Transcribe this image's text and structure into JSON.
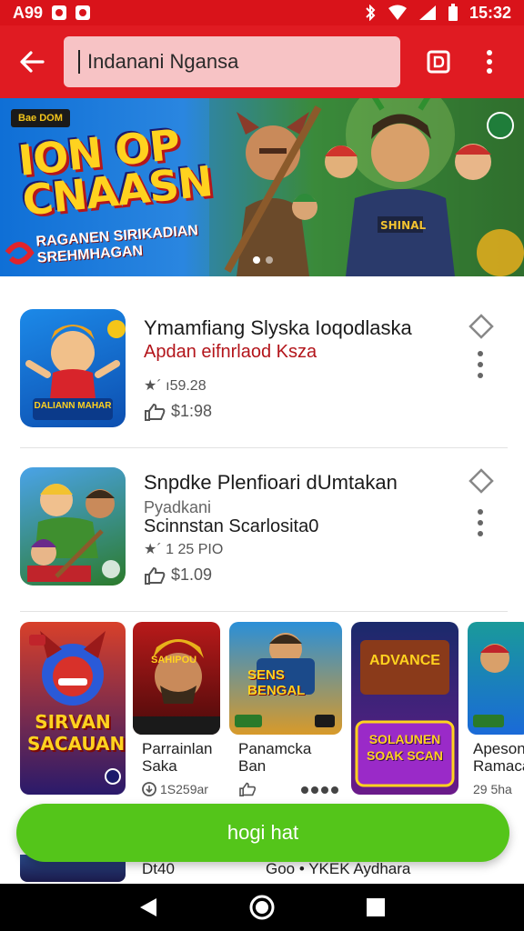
{
  "status_bar": {
    "left_text": "A99",
    "time": "15:32"
  },
  "search": {
    "value": "Indanani Ngansa"
  },
  "banner": {
    "tag": "Bae DOM",
    "title_line1": "ION OP",
    "title_line2": "CNAASN",
    "subtitle": "RAGANEN SIRIKADIAN SREHMHAGAN",
    "shirt_text": "SHINAL"
  },
  "list_items": [
    {
      "title": "Ymamfiang Slyska Ioqodlaska",
      "developer": "Apdan eifnrlaod Ksza",
      "developer_color": "#b3151b",
      "meta": "★´ ı59.28",
      "price": "$1:98",
      "icon_text": "DALIANN MAHAR"
    },
    {
      "title": "Snpdke Plenfioari dUmtakan",
      "developer": "Pyadkani",
      "subtitle": "Scinnstan Scarlosita0",
      "meta": "★´ 1 25 PIO",
      "price": "$1.09"
    }
  ],
  "cards": [
    {
      "art_text": "SIRVAN SACAUANIAS",
      "label": "",
      "meta": ""
    },
    {
      "art_text": "SAHIPOU",
      "label1": "Parrainlan",
      "label2": "Saka",
      "meta": "1S259ar"
    },
    {
      "art_text": "SENS BENGAL",
      "label1": "Panamcka",
      "label2": "Ban",
      "meta": ""
    },
    {
      "art_text": "ADVANCE",
      "art_text2": "SOLAUNEN SOAK SCAN",
      "label1": "",
      "label2": "",
      "meta": ""
    },
    {
      "art_text": "",
      "label1": "Apeson",
      "label2": "Ramaca",
      "meta": "29 5ha"
    }
  ],
  "footer_strip": {
    "left": "Dt40",
    "right": "Goo • YKEK Aydhara"
  },
  "cta": {
    "label": "hogi hat"
  }
}
